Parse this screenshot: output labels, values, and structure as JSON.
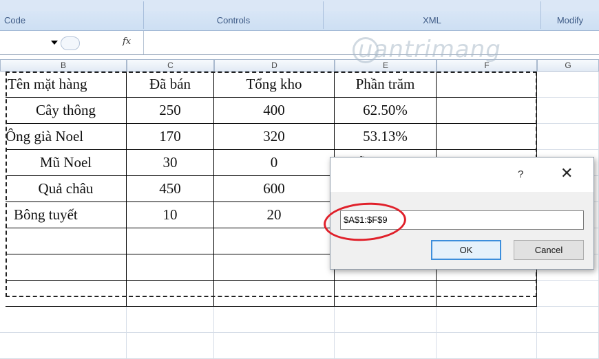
{
  "ribbon": {
    "groups": [
      {
        "label": "Code"
      },
      {
        "label": "Controls"
      },
      {
        "label": "XML"
      },
      {
        "label": "Modify"
      }
    ]
  },
  "formula_bar": {
    "fx_label": "fx"
  },
  "columns": [
    "B",
    "C",
    "D",
    "E",
    "F",
    "G"
  ],
  "table": {
    "headers": [
      "Tên mặt hàng",
      "Đã bán",
      "Tổng kho",
      "Phần trăm"
    ],
    "rows": [
      [
        "Cây thông",
        "250",
        "400",
        "62.50%"
      ],
      [
        "Ông già Noel",
        "170",
        "320",
        "53.13%"
      ],
      [
        "Mũ Noel",
        "30",
        "0",
        "Lỗi nhập sai"
      ],
      [
        "Quả châu",
        "450",
        "600",
        ""
      ],
      [
        "Bông tuyết",
        "10",
        "20",
        ""
      ]
    ]
  },
  "watermark": "uantrimang",
  "dialog": {
    "help": "?",
    "close": "✕",
    "range_value": "$A$1:$F$9",
    "ok_label": "OK",
    "cancel_label": "Cancel"
  },
  "colors": {
    "ribbon_text": "#3d5a86",
    "annotation_red": "#e0202a",
    "ok_border": "#3c8edc"
  }
}
